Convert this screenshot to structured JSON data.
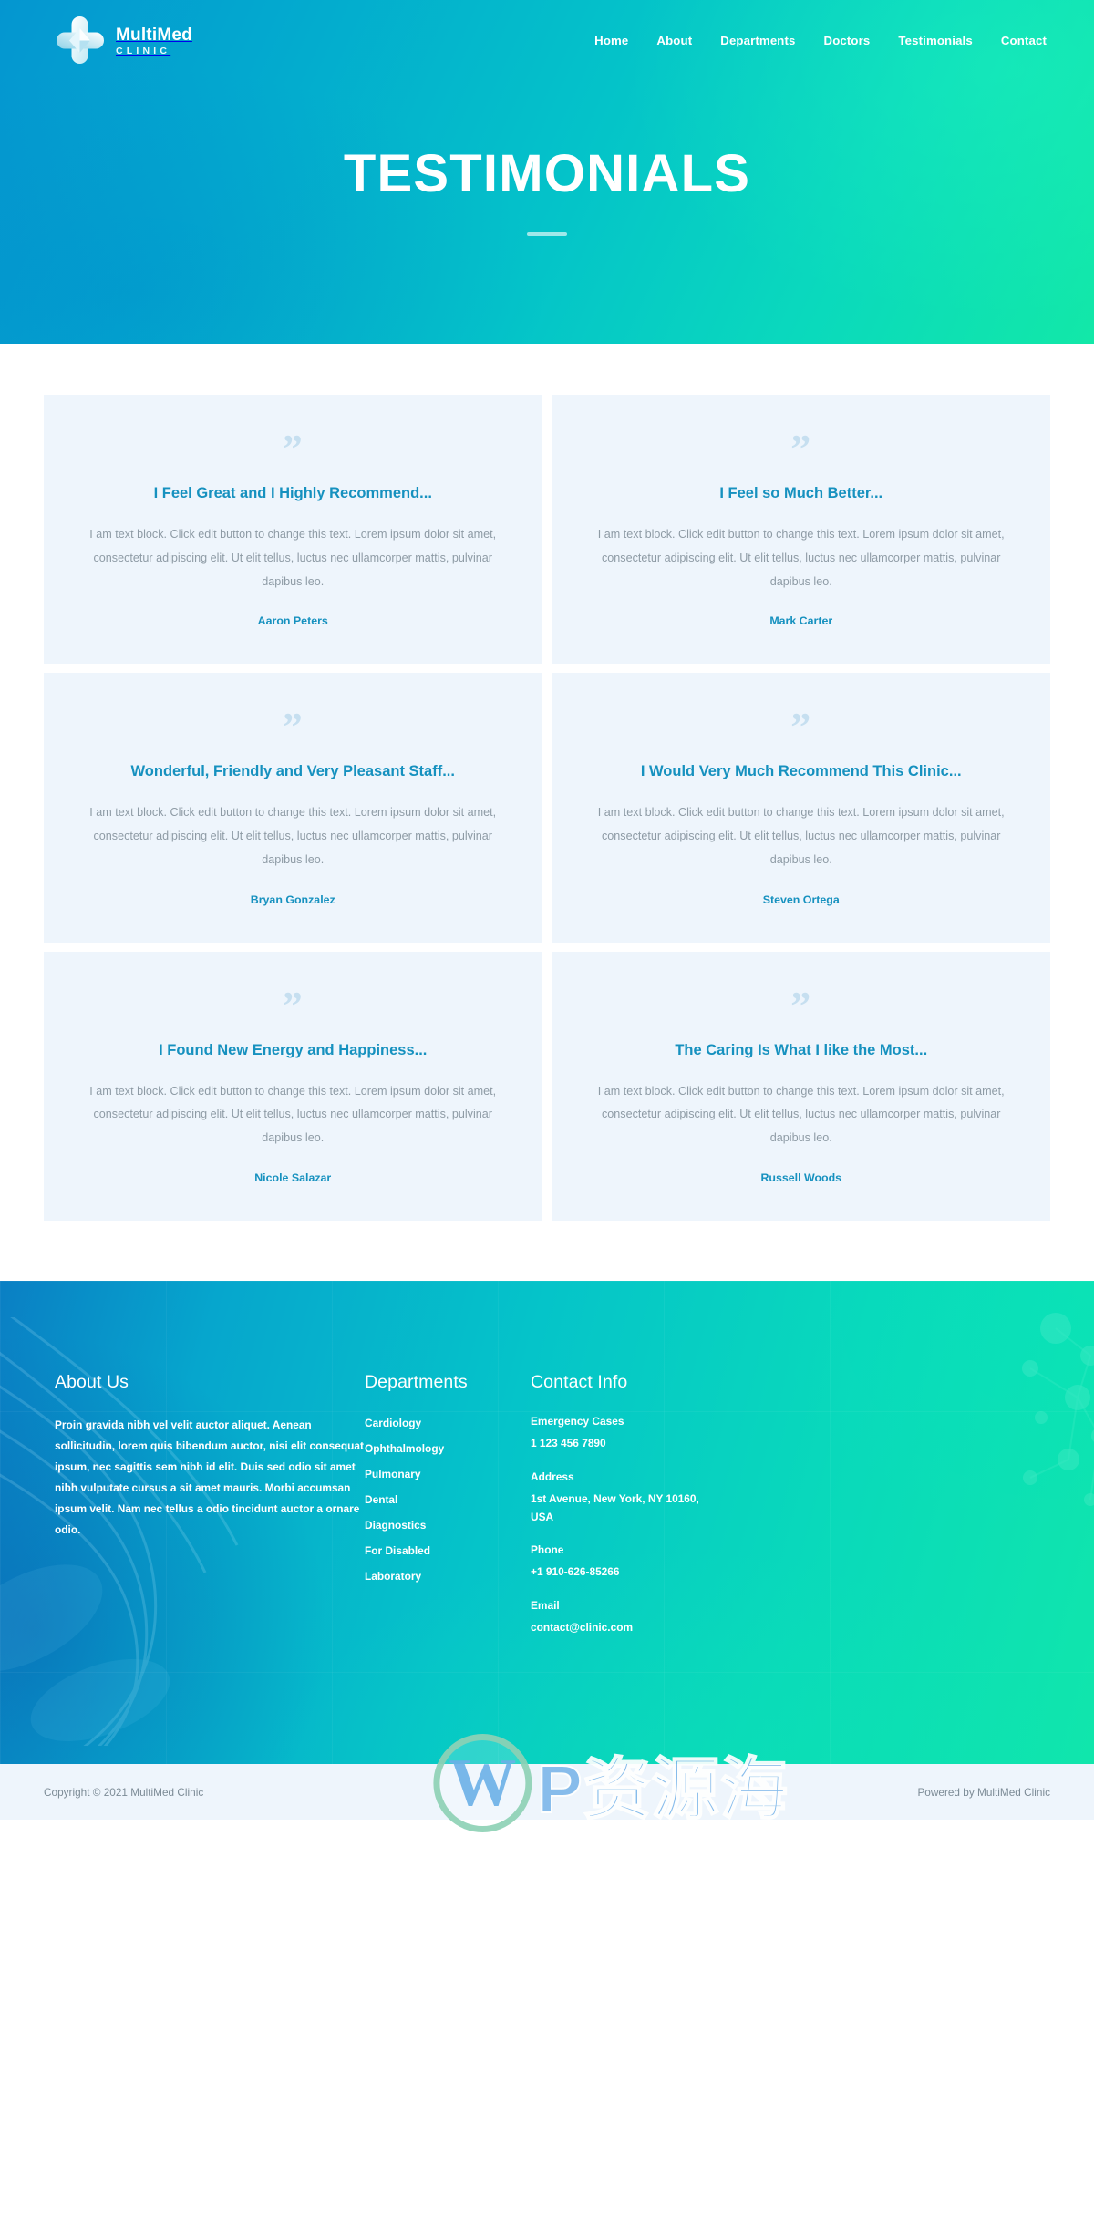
{
  "brand": {
    "name": "MultiMed",
    "tagline": "CLINIC",
    "logo_icon": "medical-cross-icon"
  },
  "nav": {
    "items": [
      {
        "label": "Home"
      },
      {
        "label": "About"
      },
      {
        "label": "Departments"
      },
      {
        "label": "Doctors"
      },
      {
        "label": "Testimonials"
      },
      {
        "label": "Contact"
      }
    ]
  },
  "hero": {
    "title": "TESTIMONIALS"
  },
  "testimonials": {
    "quote_glyph": "”",
    "items": [
      {
        "title": "I Feel Great and I Highly Recommend...",
        "text": "I am text block. Click edit button to change this text. Lorem ipsum dolor sit amet, consectetur adipiscing elit. Ut elit tellus, luctus nec ullamcorper mattis, pulvinar dapibus leo.",
        "author": "Aaron Peters"
      },
      {
        "title": "I Feel so Much Better...",
        "text": "I am text block. Click edit button to change this text. Lorem ipsum dolor sit amet, consectetur adipiscing elit. Ut elit tellus, luctus nec ullamcorper mattis, pulvinar dapibus leo.",
        "author": "Mark Carter"
      },
      {
        "title": "Wonderful, Friendly and Very Pleasant Staff...",
        "text": "I am text block. Click edit button to change this text. Lorem ipsum dolor sit amet, consectetur adipiscing elit. Ut elit tellus, luctus nec ullamcorper mattis, pulvinar dapibus leo.",
        "author": "Bryan Gonzalez"
      },
      {
        "title": "I Would Very Much Recommend This Clinic...",
        "text": "I am text block. Click edit button to change this text. Lorem ipsum dolor sit amet, consectetur adipiscing elit. Ut elit tellus, luctus nec ullamcorper mattis, pulvinar dapibus leo.",
        "author": "Steven Ortega"
      },
      {
        "title": "I Found New Energy and Happiness...",
        "text": "I am text block. Click edit button to change this text. Lorem ipsum dolor sit amet, consectetur adipiscing elit. Ut elit tellus, luctus nec ullamcorper mattis, pulvinar dapibus leo.",
        "author": "Nicole Salazar"
      },
      {
        "title": "The Caring Is What I like the Most...",
        "text": "I am text block. Click edit button to change this text. Lorem ipsum dolor sit amet, consectetur adipiscing elit. Ut elit tellus, luctus nec ullamcorper mattis, pulvinar dapibus leo.",
        "author": "Russell Woods"
      }
    ]
  },
  "footer": {
    "about": {
      "heading": "About Us",
      "body": "Proin gravida nibh vel velit auctor aliquet. Aenean sollicitudin, lorem quis bibendum auctor, nisi elit consequat ipsum, nec sagittis sem nibh id elit. Duis sed odio sit amet nibh vulputate cursus a sit amet mauris. Morbi accumsan ipsum velit. Nam nec tellus a odio tincidunt auctor a ornare odio."
    },
    "departments": {
      "heading": "Departments",
      "items": [
        {
          "label": "Cardiology"
        },
        {
          "label": "Ophthalmology"
        },
        {
          "label": "Pulmonary"
        },
        {
          "label": "Dental"
        },
        {
          "label": "Diagnostics"
        },
        {
          "label": "For Disabled"
        },
        {
          "label": "Laboratory"
        }
      ]
    },
    "contact": {
      "heading": "Contact Info",
      "blocks": [
        {
          "label": "Emergency Cases",
          "value": "1 123 456 7890"
        },
        {
          "label": "Address",
          "value": "1st Avenue, New York, NY 10160, USA"
        },
        {
          "label": "Phone",
          "value": "+1 910-626-85266"
        },
        {
          "label": "Email",
          "value": "contact@clinic.com"
        }
      ]
    }
  },
  "bottom": {
    "copyright": "Copyright © 2021 MultiMed Clinic",
    "powered": "Powered by MultiMed Clinic"
  },
  "watermark": {
    "text": "P资源海"
  },
  "colors": {
    "accent": "#1691bf",
    "card_bg": "#eef5fc",
    "gradient_start": "#0496d0",
    "gradient_end": "#12e8a8"
  }
}
